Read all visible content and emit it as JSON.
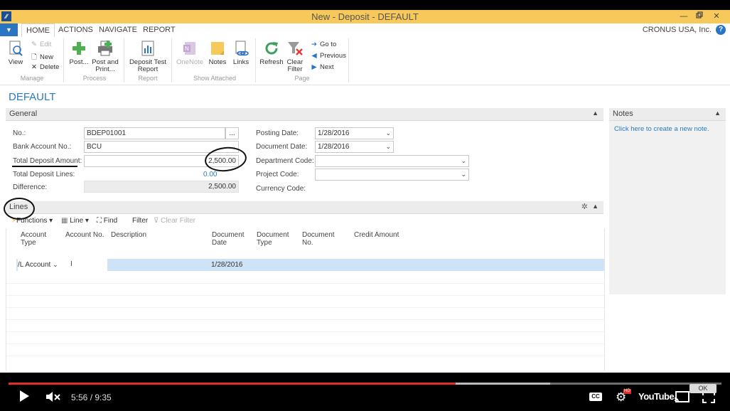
{
  "window": {
    "title": "New - Deposit - DEFAULT",
    "controls": [
      "minimize-icon",
      "maximize-icon",
      "close-icon"
    ]
  },
  "ribbon": {
    "tabs": [
      "HOME",
      "ACTIONS",
      "NAVIGATE",
      "REPORT"
    ],
    "active_tab": "HOME",
    "company": "CRONUS USA, Inc.",
    "groups": {
      "manage": {
        "label": "Manage",
        "view": "View",
        "edit": "Edit",
        "new": "New",
        "delete": "Delete"
      },
      "process": {
        "label": "Process",
        "post": "Post...",
        "post_and_print": [
          "Post and",
          "Print..."
        ]
      },
      "report": {
        "label": "Report",
        "deposit_test_report": [
          "Deposit Test",
          "Report"
        ]
      },
      "show_attached": {
        "label": "Show Attached",
        "onenote": "OneNote",
        "notes": "Notes",
        "links": "Links"
      },
      "page": {
        "label": "Page",
        "refresh": "Refresh",
        "clear_filter": [
          "Clear",
          "Filter"
        ],
        "go_to": "Go to",
        "previous": "Previous",
        "next": "Next"
      }
    }
  },
  "page": {
    "title": "DEFAULT"
  },
  "general": {
    "header": "General",
    "fields": {
      "no": {
        "label": "No.:",
        "value": "BDEP01001",
        "ellipsis": "..."
      },
      "bank_account_no": {
        "label": "Bank Account No.:",
        "value": "BCU"
      },
      "total_deposit_amount": {
        "label": "Total Deposit Amount:",
        "value": "2,500.00"
      },
      "total_deposit_lines": {
        "label": "Total Deposit Lines:",
        "value": "0.00"
      },
      "difference": {
        "label": "Difference:",
        "value": "2,500.00"
      },
      "posting_date": {
        "label": "Posting Date:",
        "value": "1/28/2016"
      },
      "document_date": {
        "label": "Document Date:",
        "value": "1/28/2016"
      },
      "department_code": {
        "label": "Department Code:",
        "value": ""
      },
      "project_code": {
        "label": "Project Code:",
        "value": ""
      },
      "currency_code": {
        "label": "Currency Code:",
        "value": ""
      }
    }
  },
  "notes": {
    "header": "Notes",
    "create_link": "Click here to create a new note."
  },
  "lines": {
    "header": "Lines",
    "toolbar": {
      "functions": "Functions",
      "line": "Line",
      "find": "Find",
      "filter": "Filter",
      "clear_filter": "Clear Filter"
    },
    "columns": [
      [
        "Account",
        "Type"
      ],
      [
        "Account No."
      ],
      [
        "Description"
      ],
      [
        "Document",
        "Date"
      ],
      [
        "Document",
        "Type"
      ],
      [
        "Document",
        "No."
      ],
      [
        "Credit Amount"
      ]
    ],
    "rows": [
      {
        "account_type": "/L Account",
        "account_no": "",
        "description": "",
        "document_date": "1/28/2016",
        "document_type": "",
        "document_no": "",
        "credit_amount": ""
      }
    ]
  },
  "player": {
    "time": "5:56 / 9:35",
    "progress": 0.627,
    "buffered": 0.76,
    "ok_label": "OK",
    "youtube_label": "YouTube",
    "cc_label": "CC",
    "hd_label": "HD",
    "colors": {
      "progress": "#e52d27",
      "accent": "#2a7abf",
      "titlebar": "#f7c85a"
    }
  }
}
